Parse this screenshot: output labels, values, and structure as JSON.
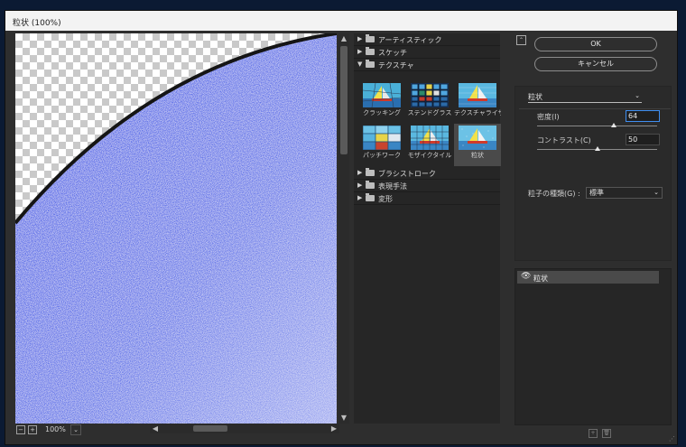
{
  "window": {
    "title": "粒状 (100%)"
  },
  "preview": {
    "zoom": "100%",
    "icons": {
      "zoom_out": "minus-icon",
      "zoom_in": "plus-icon",
      "zoom_menu": "chevron-down-icon"
    }
  },
  "gallery": {
    "categories": [
      {
        "label": "アーティスティック",
        "expanded": false
      },
      {
        "label": "スケッチ",
        "expanded": false
      },
      {
        "label": "テクスチャ",
        "expanded": true
      },
      {
        "label": "ブラシストローク",
        "expanded": false
      },
      {
        "label": "表現手法",
        "expanded": false
      },
      {
        "label": "変形",
        "expanded": false
      }
    ],
    "texture_filters": [
      {
        "label": "クラッキング",
        "selected": false
      },
      {
        "label": "ステンドグラス",
        "selected": false
      },
      {
        "label": "テクスチャライザー",
        "selected": false
      },
      {
        "label": "パッチワーク",
        "selected": false
      },
      {
        "label": "モザイクタイル",
        "selected": false
      },
      {
        "label": "粒状",
        "selected": true
      }
    ]
  },
  "buttons": {
    "ok": "OK",
    "cancel": "キャンセル"
  },
  "settings": {
    "filter_select": "粒状",
    "intensity_label": "密度(I)",
    "intensity_value": "64",
    "intensity_fraction": 0.64,
    "contrast_label": "コントラスト(C)",
    "contrast_value": "50",
    "contrast_fraction": 0.5,
    "grain_type_label": "粒子の種類(G) :",
    "grain_type_value": "標準"
  },
  "layers": {
    "items": [
      {
        "name": "粒状",
        "visible": true
      }
    ]
  },
  "colors": {
    "accent": "#3f8ef0",
    "preview_blue": "#4f63e0",
    "dialog_bg": "#2e2e2e"
  }
}
